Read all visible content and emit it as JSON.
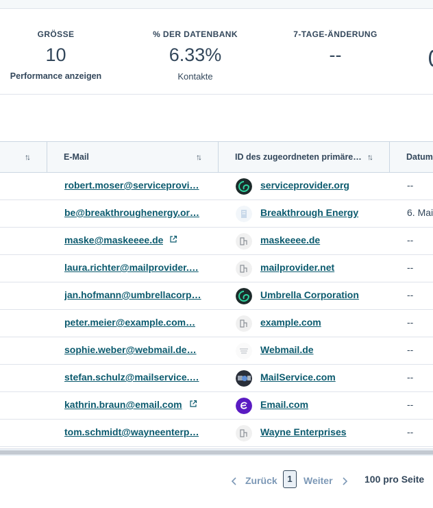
{
  "stats": [
    {
      "label": "GRÖSSE",
      "value": "10",
      "sub": "Performance anzeigen"
    },
    {
      "label": "% DER DATENBANK",
      "value": "6.33%",
      "sub": "Kontakte"
    },
    {
      "label": "7-TAGE-ÄNDERUNG",
      "value": "--",
      "sub": ""
    }
  ],
  "table": {
    "headers": {
      "email": "E-Mail",
      "company": "ID des zugeordneten primäre…",
      "date": "Datum"
    },
    "rows": [
      {
        "email": "robert.moser@serviceprovi…",
        "company": "serviceprovider.org",
        "date": "--",
        "logo": "green-swirl"
      },
      {
        "email": "be@breakthroughenergy.or…",
        "company": "Breakthrough Energy",
        "date": "6. Mai",
        "logo": "building-blue"
      },
      {
        "email": "maske@maskeeee.de",
        "company": "maskeeee.de",
        "date": "--",
        "logo": "building-grey"
      },
      {
        "email": "laura.richter@mailprovider.…",
        "company": "mailprovider.net",
        "date": "--",
        "logo": "building-grey"
      },
      {
        "email": "jan.hofmann@umbrellacorp…",
        "company": "Umbrella Corporation",
        "date": "--",
        "logo": "green-swirl"
      },
      {
        "email": "peter.meier@example.com…",
        "company": "example.com",
        "date": "--",
        "logo": "building-grey"
      },
      {
        "email": "sophie.weber@webmail.de…",
        "company": "Webmail.de",
        "date": "--",
        "logo": "stack-grey"
      },
      {
        "email": "stefan.schulz@mailservice.…",
        "company": "MailService.com",
        "date": "--",
        "logo": "photo"
      },
      {
        "email": "kathrin.braun@email.com",
        "company": "Email.com",
        "date": "--",
        "logo": "purple-e"
      },
      {
        "email": "tom.schmidt@wayneenterp…",
        "company": "Wayne Enterprises",
        "date": "--",
        "logo": "building-grey"
      }
    ]
  },
  "pagination": {
    "prev": "Zurück",
    "page": "1",
    "next": "Weiter",
    "per_page": "100 pro Seite"
  },
  "colors": {
    "link": "#0b5a6e",
    "text": "#33475b",
    "header_bg": "#f5f8fa"
  }
}
